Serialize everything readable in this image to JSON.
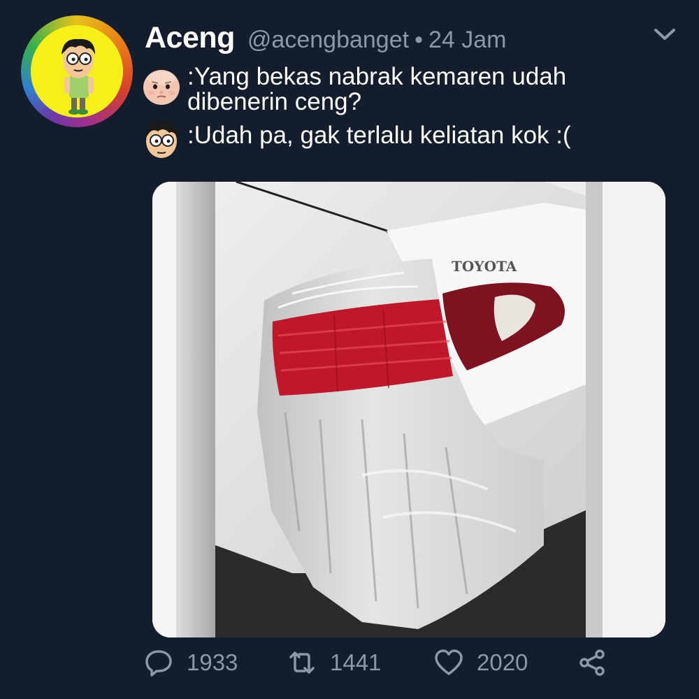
{
  "tweet": {
    "author_name": "Aceng",
    "handle": "@acengbanget",
    "separator": "•",
    "time": "24 Jam",
    "avatar_icon": "cartoon-boy-avatar",
    "menu_icon": "chevron-down-icon"
  },
  "dialogue": [
    {
      "speaker_icon": "baby-face-icon",
      "text": ":Yang bekas nabrak kemaren udah dibenerin ceng?"
    },
    {
      "speaker_icon": "cartoon-boy-face-icon",
      "text": ":Udah pa, gak terlalu keliatan kok :("
    }
  ],
  "media": {
    "brand_text": "TOYOTA"
  },
  "actions": {
    "replies": "1933",
    "retweets": "1441",
    "likes": "2020"
  },
  "colors": {
    "background": "#141d2b",
    "text": "#ffffff",
    "muted": "#8b98a8",
    "taillight_red": "#c0182a"
  }
}
